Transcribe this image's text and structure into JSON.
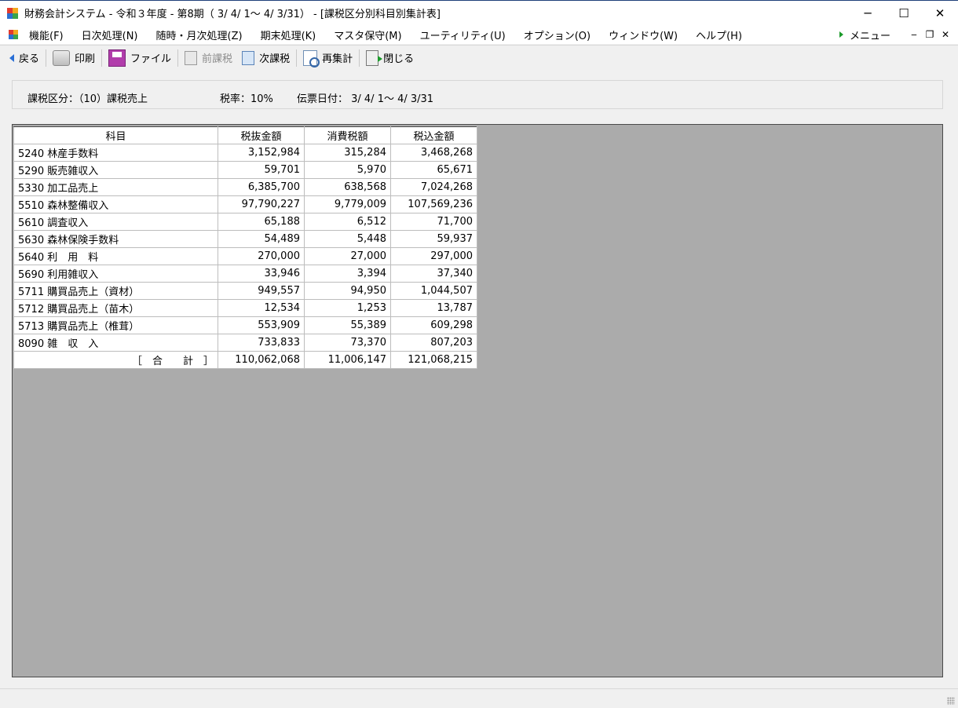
{
  "window": {
    "title": "財務会計システム - 令和３年度 - 第8期（ 3/ 4/ 1～ 4/ 3/31） - [課税区分別科目別集計表]",
    "minimize": "─",
    "maximize": "☐",
    "close": "✕"
  },
  "menu": {
    "items": [
      "機能(F)",
      "日次処理(N)",
      "随時・月次処理(Z)",
      "期末処理(K)",
      "マスタ保守(M)",
      "ユーティリティ(U)",
      "オプション(O)",
      "ウィンドウ(W)",
      "ヘルプ(H)"
    ],
    "right_label": "メニュー",
    "mdi_min": "‒",
    "mdi_restore": "❐",
    "mdi_close": "✕"
  },
  "toolbar": {
    "back": "戻る",
    "print": "印刷",
    "file": "ファイル",
    "prev_tax": "前課税",
    "next_tax": "次課税",
    "recalc": "再集計",
    "close": "閉じる"
  },
  "info": {
    "tax_category": "課税区分：（10）課税売上",
    "tax_rate": "税率：10%",
    "slip_date": "伝票日付： 3/ 4/ 1～ 4/ 3/31"
  },
  "table": {
    "headers": [
      "科目",
      "税抜金額",
      "消費税額",
      "税込金額"
    ],
    "rows": [
      [
        "5240 林産手数料",
        "3,152,984",
        "315,284",
        "3,468,268"
      ],
      [
        "5290 販売雑収入",
        "59,701",
        "5,970",
        "65,671"
      ],
      [
        "5330 加工品売上",
        "6,385,700",
        "638,568",
        "7,024,268"
      ],
      [
        "5510 森林整備収入",
        "97,790,227",
        "9,779,009",
        "107,569,236"
      ],
      [
        "5610 調査収入",
        "65,188",
        "6,512",
        "71,700"
      ],
      [
        "5630 森林保険手数料",
        "54,489",
        "5,448",
        "59,937"
      ],
      [
        "5640 利　用　料",
        "270,000",
        "27,000",
        "297,000"
      ],
      [
        "5690 利用雑収入",
        "33,946",
        "3,394",
        "37,340"
      ],
      [
        "5711 購買品売上（資材）",
        "949,557",
        "94,950",
        "1,044,507"
      ],
      [
        "5712 購買品売上（苗木）",
        "12,534",
        "1,253",
        "13,787"
      ],
      [
        "5713 購買品売上（椎茸）",
        "553,909",
        "55,389",
        "609,298"
      ],
      [
        "8090 雑　収　入",
        "733,833",
        "73,370",
        "807,203"
      ]
    ],
    "total": [
      "［　合　　計　］",
      "110,062,068",
      "11,006,147",
      "121,068,215"
    ]
  }
}
